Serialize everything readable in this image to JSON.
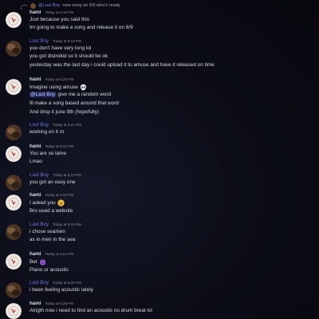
{
  "reply": {
    "name": "@Last Boy",
    "text": "new song on 6/9 who's ready"
  },
  "messages": [
    {
      "user": "hami",
      "time": "Today at 6:18 PM",
      "lines": [
        "Just because you said this",
        "Im going to make a song and release it on 6/9"
      ]
    },
    {
      "user": "Last Boy",
      "time": "Today at 6:19 PM",
      "lines": [
        "you don't have very long lol",
        "you got distrokid so it should be ok",
        "yesterday was the last day i could upload it to amuse and have it released on time"
      ]
    },
    {
      "user": "hami",
      "time": "Today at 6:20 PM",
      "lines": [
        "Imagine using amuse",
        "give me a random word",
        "Ill make a song based around that word",
        "And drop it june 9th (hopefully)"
      ],
      "mention": "@Last Boy"
    },
    {
      "user": "Last Boy",
      "time": "Today at 6:22 PM",
      "lines": [
        "working on it rn"
      ]
    },
    {
      "user": "hami",
      "time": "Today at 6:22 PM",
      "lines": [
        "You are so lame",
        "Lmao"
      ]
    },
    {
      "user": "Last Boy",
      "time": "Today at 6:23 PM",
      "lines": [
        "you got an easy one"
      ]
    },
    {
      "user": "hami",
      "time": "Today at 6:23 PM",
      "lines": [
        "I asked you",
        "Bro used a website"
      ]
    },
    {
      "user": "Last Boy",
      "time": "Today at 6:24 PM",
      "lines": [
        "i chose seamen",
        "as in men in the sea"
      ]
    },
    {
      "user": "hami",
      "time": "Today at 6:24 PM",
      "lines": [
        "Bet",
        "Piano or acoustic"
      ]
    },
    {
      "user": "Last Boy",
      "time": "Today at 6:25 PM",
      "lines": [
        "i been feeling acoustic lately"
      ]
    },
    {
      "user": "hami",
      "time": "Today at 6:25 PM",
      "lines": [
        "Alrigth now i need to find an acoustic no drum breat lol"
      ]
    }
  ],
  "emojis": {
    "skull": "skull-emoji",
    "grin": "grin-emoji",
    "devil": "smiling-devil-emoji"
  },
  "colors": {
    "mention_name": "#6d74e0",
    "background": "#0b0c16"
  }
}
